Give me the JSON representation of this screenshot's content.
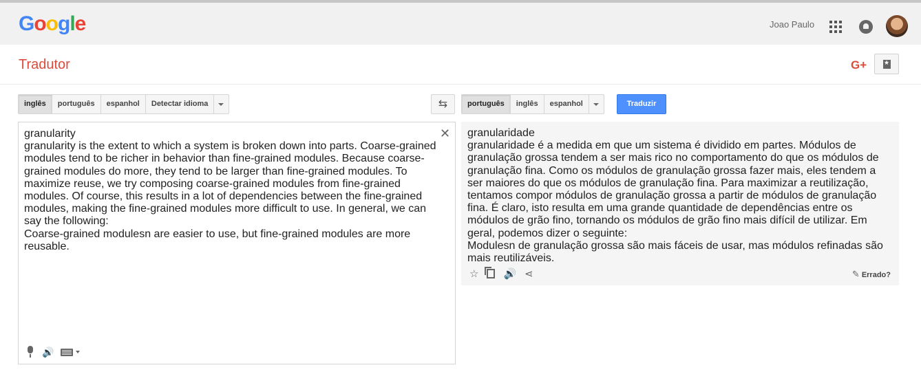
{
  "header": {
    "logo_letters": [
      {
        "ch": "G",
        "color": "#4285f4"
      },
      {
        "ch": "o",
        "color": "#ea4335"
      },
      {
        "ch": "o",
        "color": "#fbbc05"
      },
      {
        "ch": "g",
        "color": "#4285f4"
      },
      {
        "ch": "l",
        "color": "#34a853"
      },
      {
        "ch": "e",
        "color": "#ea4335"
      }
    ],
    "user_name": "Joao Paulo"
  },
  "subheader": {
    "title": "Tradutor",
    "gplus_label": "G+"
  },
  "source": {
    "languages": [
      "inglês",
      "português",
      "espanhol",
      "Detectar idioma"
    ],
    "selected": "inglês",
    "text": "granularity\ngranularity is the extent to which a system is broken down into parts. Coarse-grained modules tend to be richer in behavior than fine-grained modules. Because coarse-grained modules do more, they tend to be larger than fine-grained modules. To maximize reuse, we try composing coarse-grained modules from fine-grained modules. Of course, this results in a lot of dependencies between the fine-grained modules, making the fine-grained modules more difficult to use. In general, we can say the following:\nCoarse-grained modulesn are easier to use, but fine-grained modules are more reusable.",
    "clear_glyph": "✕"
  },
  "target": {
    "languages": [
      "português",
      "inglês",
      "espanhol"
    ],
    "selected": "português",
    "translate_label": "Traduzir",
    "text": "granularidade\ngranularidade é a medida em que um sistema é dividido em partes. Módulos de granulação grossa tendem a ser mais rico no comportamento do que os módulos de granulação fina. Como os módulos de granulação grossa fazer mais, eles tendem a ser maiores do que os módulos de granulação fina. Para maximizar a reutilização, tentamos compor módulos de granulação grossa a partir de módulos de granulação fina. É claro, isto resulta em uma grande quantidade de dependências entre os módulos de grão fino, tornando os módulos de grão fino mais difícil de utilizar. Em geral, podemos dizer o seguinte:\nModulesn de granulação grossa são mais fáceis de usar, mas módulos refinadas são mais reutilizáveis.",
    "wrong_label": "Errado?"
  },
  "icons": {
    "swap": "swap-icon",
    "star": "☆",
    "speaker": "🔊",
    "share": "⋖",
    "pencil": "✎"
  }
}
